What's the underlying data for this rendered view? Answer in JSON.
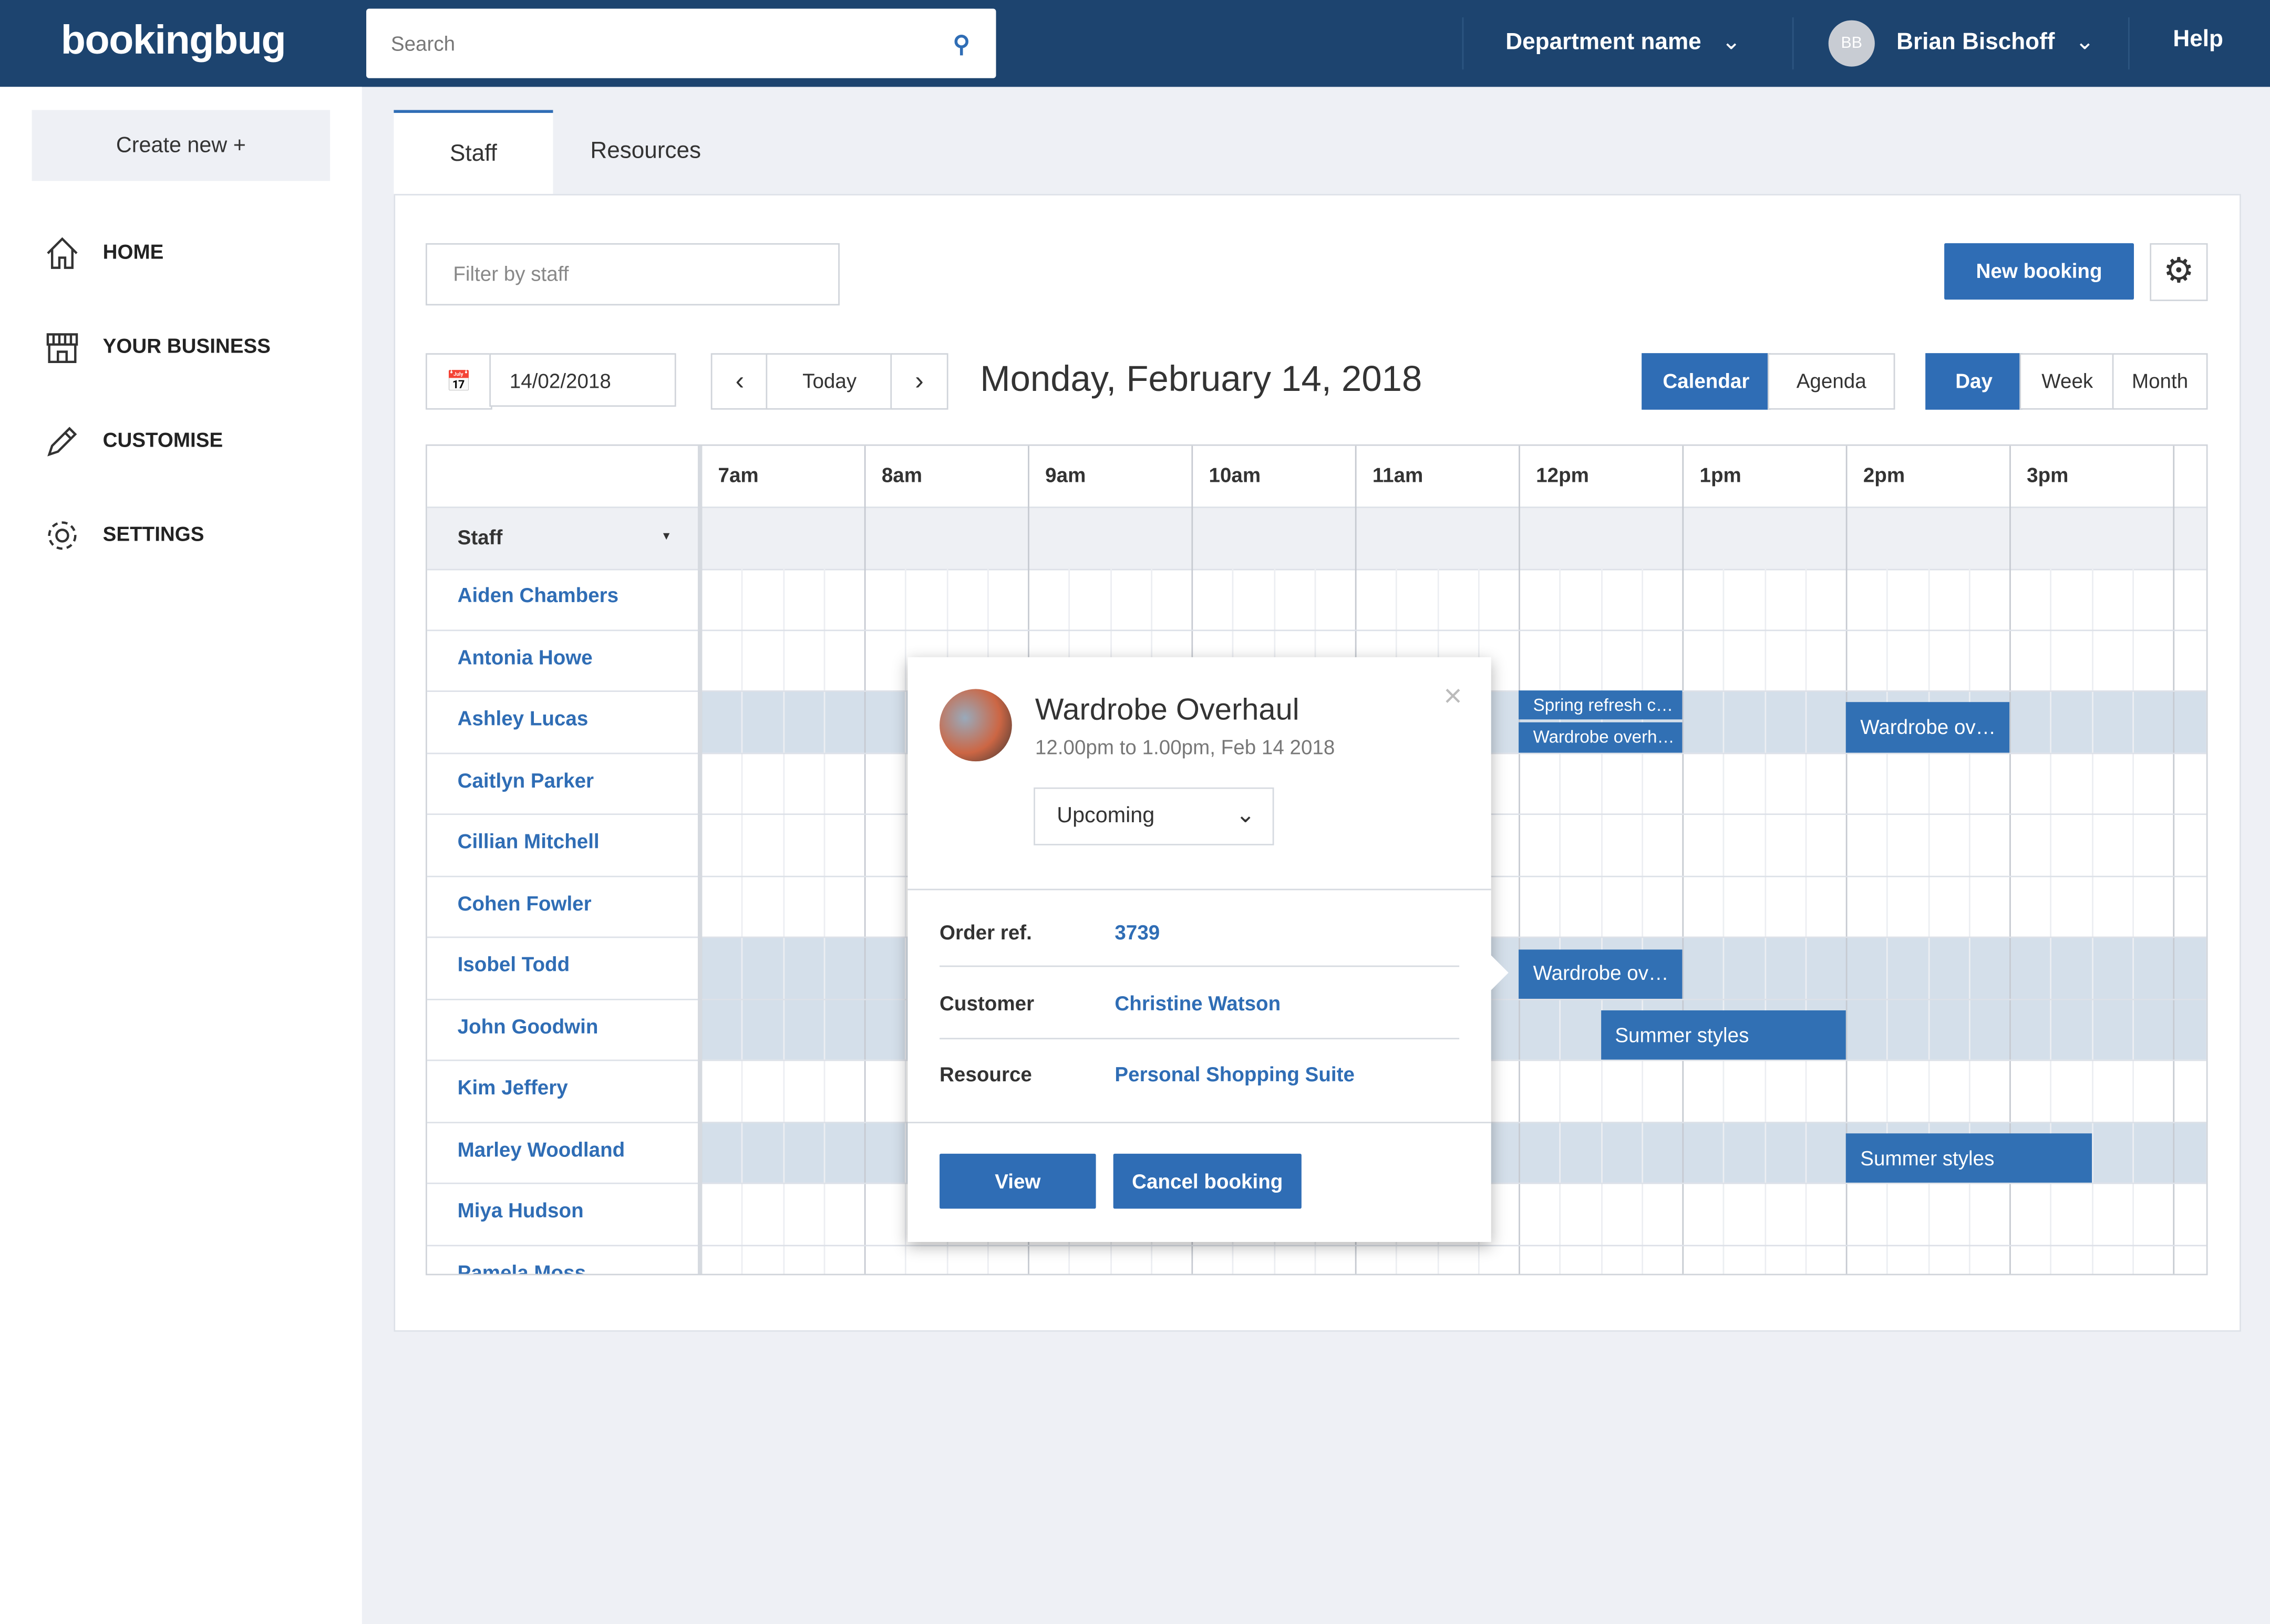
{
  "topbar": {
    "logo": "bookingbug",
    "search_placeholder": "Search",
    "department": "Department name",
    "user_initials": "BB",
    "user_name": "Brian Bischoff",
    "help": "Help"
  },
  "sidebar": {
    "create_new": "Create new +",
    "items": [
      {
        "label": "HOME",
        "icon": "home-icon"
      },
      {
        "label": "YOUR BUSINESS",
        "icon": "store-icon"
      },
      {
        "label": "CUSTOMISE",
        "icon": "pencil-icon"
      },
      {
        "label": "SETTINGS",
        "icon": "gear-icon"
      }
    ]
  },
  "tabs": [
    {
      "label": "Staff",
      "active": true
    },
    {
      "label": "Resources",
      "active": false
    }
  ],
  "toolbar": {
    "filter_placeholder": "Filter by staff",
    "new_booking": "New booking",
    "date_value": "14/02/2018",
    "today": "Today",
    "prev": "‹",
    "next": "›",
    "date_title": "Monday, February 14, 2018",
    "views": [
      {
        "label": "Calendar",
        "active": true
      },
      {
        "label": "Agenda",
        "active": false
      }
    ],
    "ranges": [
      {
        "label": "Day",
        "active": true
      },
      {
        "label": "Week",
        "active": false
      },
      {
        "label": "Month",
        "active": false
      }
    ]
  },
  "calendar": {
    "hours": [
      "7am",
      "8am",
      "9am",
      "10am",
      "11am",
      "12pm",
      "1pm",
      "2pm",
      "3pm"
    ],
    "staff_header": "Staff",
    "staff": [
      "Aiden Chambers",
      "Antonia Howe",
      "Ashley Lucas",
      "Caitlyn Parker",
      "Cillian Mitchell",
      "Cohen Fowler",
      "Isobel Todd",
      "John Goodwin",
      "Kim Jeffery",
      "Marley Woodland",
      "Miya Hudson",
      "Pamela Moss"
    ],
    "highlighted_rows": [
      2,
      6,
      7,
      9
    ],
    "events": [
      {
        "staff": 2,
        "label": "Spring refresh c…",
        "start": 12,
        "end": 13,
        "half": "top"
      },
      {
        "staff": 2,
        "label": "Wardrobe overh…",
        "start": 12,
        "end": 13,
        "half": "bottom"
      },
      {
        "staff": 2,
        "label": "Wardrobe ov…",
        "start": 14,
        "end": 15
      },
      {
        "staff": 6,
        "label": "Wardrobe ov…",
        "start": 12,
        "end": 13
      },
      {
        "staff": 7,
        "label": "Summer styles",
        "start": 12.5,
        "end": 14
      },
      {
        "staff": 9,
        "label": "Summer styles",
        "start": 14,
        "end": 15.5
      }
    ]
  },
  "popup": {
    "title": "Wardrobe Overhaul",
    "time": "12.00pm to 1.00pm, Feb 14 2018",
    "status": "Upcoming",
    "order_label": "Order ref.",
    "order_value": "3739",
    "customer_label": "Customer",
    "customer_value": "Christine Watson",
    "resource_label": "Resource",
    "resource_value": "Personal Shopping Suite",
    "view": "View",
    "cancel": "Cancel booking",
    "close": "×"
  },
  "colors": {
    "nav": "#1d446f",
    "accent": "#2f6db5",
    "highlight_row": "#d4dfea"
  }
}
